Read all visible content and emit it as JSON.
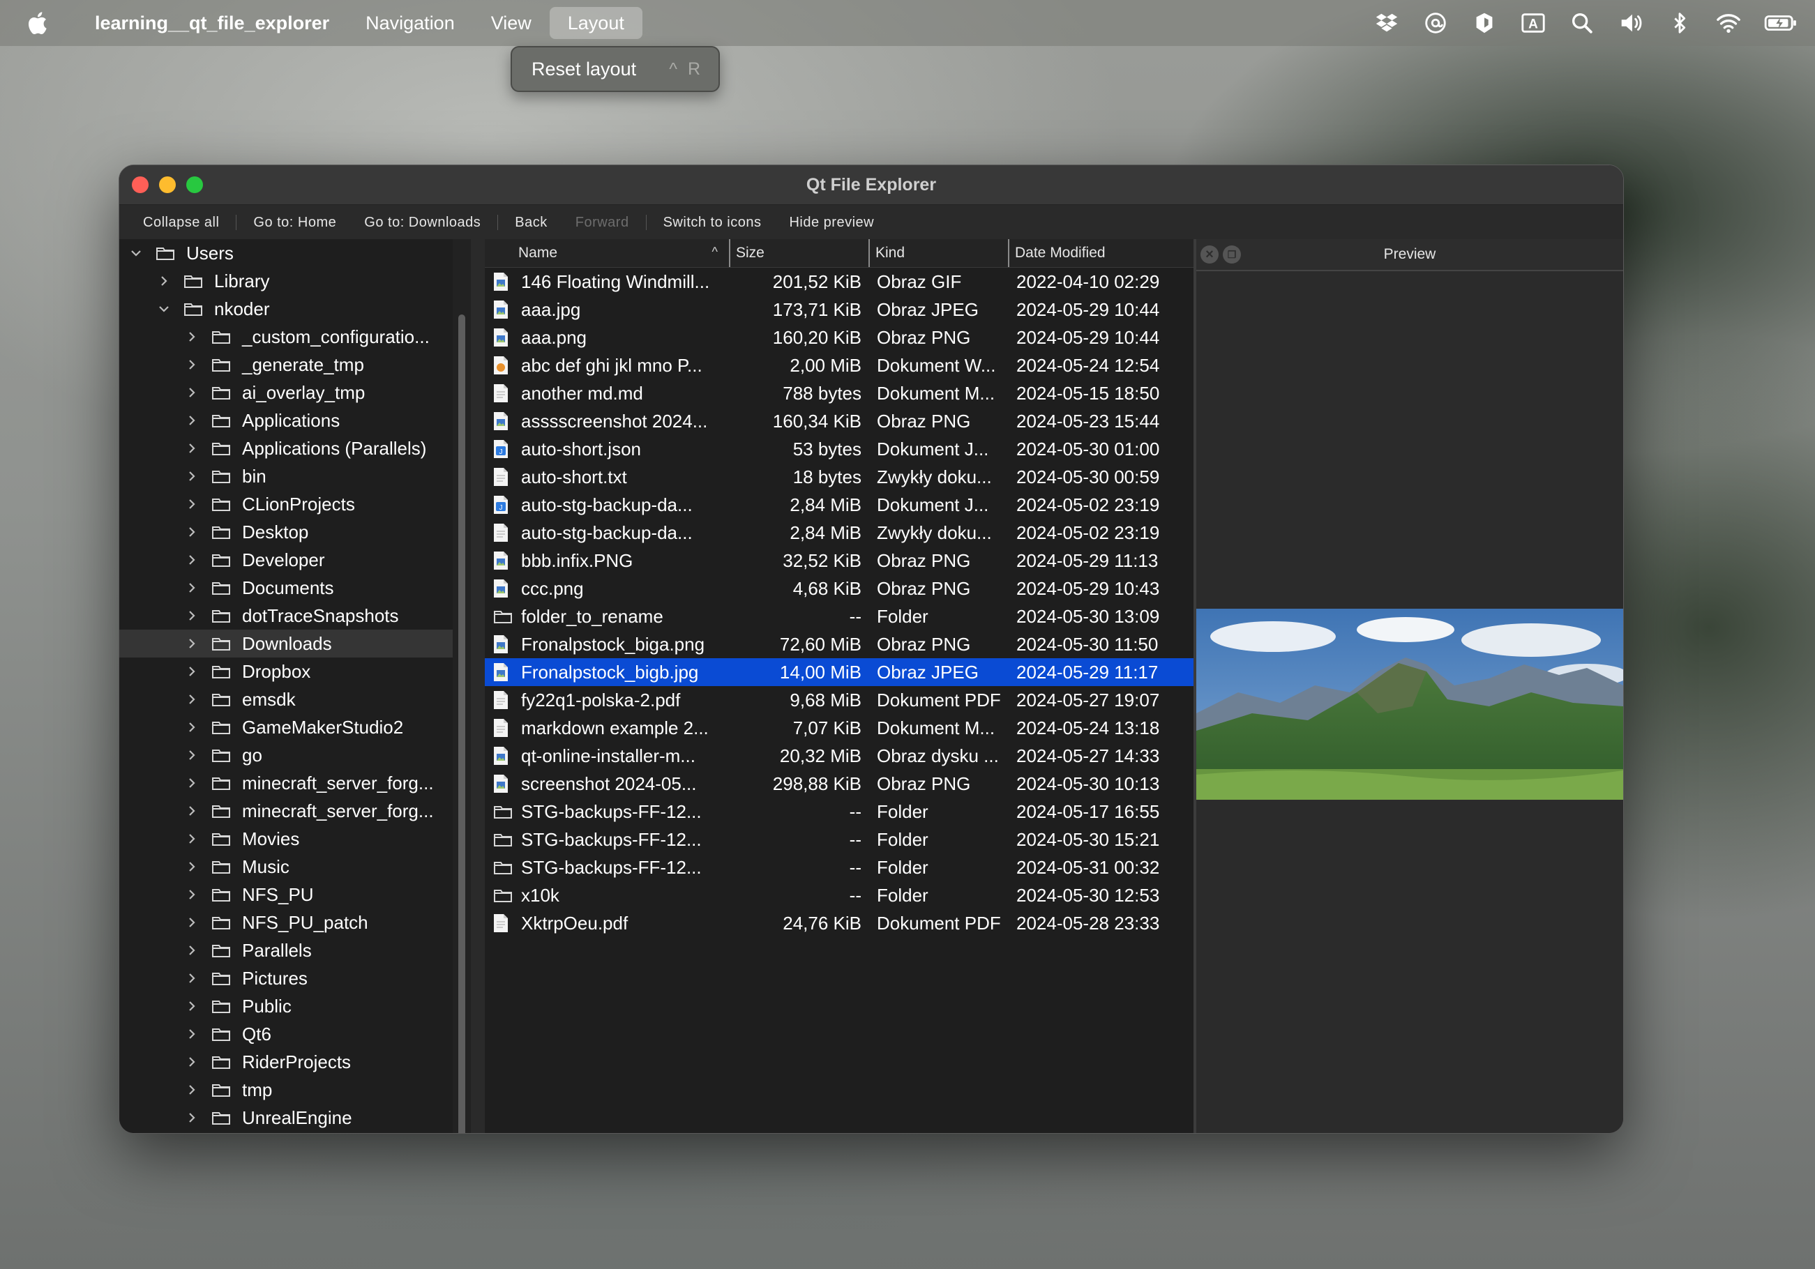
{
  "menubar": {
    "app_name": "learning__qt_file_explorer",
    "items": [
      "Navigation",
      "View",
      "Layout"
    ],
    "active_item": "Layout"
  },
  "layout_menu": {
    "reset_label": "Reset layout",
    "reset_shortcut": "^ R"
  },
  "window": {
    "title": "Qt File Explorer"
  },
  "toolbar": {
    "collapse_all": "Collapse all",
    "go_home": "Go to: Home",
    "go_downloads": "Go to: Downloads",
    "back": "Back",
    "forward": "Forward",
    "switch_icons": "Switch to icons",
    "hide_preview": "Hide preview"
  },
  "tree": {
    "root": "Users",
    "library": "Library",
    "user": "nkoder",
    "selected": "Downloads",
    "items": [
      "_custom_configuratio...",
      "_generate_tmp",
      "ai_overlay_tmp",
      "Applications",
      "Applications (Parallels)",
      "bin",
      "CLionProjects",
      "Desktop",
      "Developer",
      "Documents",
      "dotTraceSnapshots",
      "Downloads",
      "Dropbox",
      "emsdk",
      "GameMakerStudio2",
      "go",
      "minecraft_server_forg...",
      "minecraft_server_forg...",
      "Movies",
      "Music",
      "NFS_PU",
      "NFS_PU_patch",
      "Parallels",
      "Pictures",
      "Public",
      "Qt6",
      "RiderProjects",
      "tmp",
      "UnrealEngine"
    ]
  },
  "list": {
    "columns": {
      "name": "Name",
      "size": "Size",
      "kind": "Kind",
      "date": "Date Modified"
    },
    "sort_indicator": "^",
    "selected_name": "Fronalpstock_bigb.jpg",
    "rows": [
      {
        "name": "146 Floating Windmill...",
        "size": "201,52 KiB",
        "kind": "Obraz GIF",
        "date": "2022-04-10 02:29",
        "icon": "image-file"
      },
      {
        "name": "aaa.jpg",
        "size": "173,71 KiB",
        "kind": "Obraz JPEG",
        "date": "2024-05-29 10:44",
        "icon": "image-file"
      },
      {
        "name": "aaa.png",
        "size": "160,20 KiB",
        "kind": "Obraz PNG",
        "date": "2024-05-29 10:44",
        "icon": "image-file"
      },
      {
        "name": "abc def ghi jkl mno P...",
        "size": "2,00 MiB",
        "kind": "Dokument W...",
        "date": "2024-05-24 12:54",
        "icon": "orange-doc"
      },
      {
        "name": "another md.md",
        "size": "788 bytes",
        "kind": "Dokument M...",
        "date": "2024-05-15 18:50",
        "icon": "text-file"
      },
      {
        "name": "asssscreenshot 2024...",
        "size": "160,34 KiB",
        "kind": "Obraz PNG",
        "date": "2024-05-23 15:44",
        "icon": "image-file"
      },
      {
        "name": "auto-short.json",
        "size": "53 bytes",
        "kind": "Dokument J...",
        "date": "2024-05-30 01:00",
        "icon": "json-file"
      },
      {
        "name": "auto-short.txt",
        "size": "18 bytes",
        "kind": "Zwykły doku...",
        "date": "2024-05-30 00:59",
        "icon": "text-file"
      },
      {
        "name": "auto-stg-backup-da...",
        "size": "2,84 MiB",
        "kind": "Dokument J...",
        "date": "2024-05-02 23:19",
        "icon": "json-file"
      },
      {
        "name": "auto-stg-backup-da...",
        "size": "2,84 MiB",
        "kind": "Zwykły doku...",
        "date": "2024-05-02 23:19",
        "icon": "text-file"
      },
      {
        "name": "bbb.infix.PNG",
        "size": "32,52 KiB",
        "kind": "Obraz PNG",
        "date": "2024-05-29 11:13",
        "icon": "image-file"
      },
      {
        "name": "ccc.png",
        "size": "4,68 KiB",
        "kind": "Obraz PNG",
        "date": "2024-05-29 10:43",
        "icon": "image-file"
      },
      {
        "name": "folder_to_rename",
        "size": "--",
        "kind": "Folder",
        "date": "2024-05-30 13:09",
        "icon": "folder"
      },
      {
        "name": "Fronalpstock_biga.png",
        "size": "72,60 MiB",
        "kind": "Obraz PNG",
        "date": "2024-05-30 11:50",
        "icon": "image-file"
      },
      {
        "name": "Fronalpstock_bigb.jpg",
        "size": "14,00 MiB",
        "kind": "Obraz JPEG",
        "date": "2024-05-29 11:17",
        "icon": "image-file"
      },
      {
        "name": "fy22q1-polska-2.pdf",
        "size": "9,68 MiB",
        "kind": "Dokument PDF",
        "date": "2024-05-27 19:07",
        "icon": "text-file"
      },
      {
        "name": "markdown example 2...",
        "size": "7,07 KiB",
        "kind": "Dokument M...",
        "date": "2024-05-24 13:18",
        "icon": "text-file"
      },
      {
        "name": "qt-online-installer-m...",
        "size": "20,32 MiB",
        "kind": "Obraz dysku ...",
        "date": "2024-05-27 14:33",
        "icon": "image-file"
      },
      {
        "name": "screenshot 2024-05...",
        "size": "298,88 KiB",
        "kind": "Obraz PNG",
        "date": "2024-05-30 10:13",
        "icon": "image-file"
      },
      {
        "name": "STG-backups-FF-12...",
        "size": "--",
        "kind": "Folder",
        "date": "2024-05-17 16:55",
        "icon": "folder"
      },
      {
        "name": "STG-backups-FF-12...",
        "size": "--",
        "kind": "Folder",
        "date": "2024-05-30 15:21",
        "icon": "folder"
      },
      {
        "name": "STG-backups-FF-12...",
        "size": "--",
        "kind": "Folder",
        "date": "2024-05-31 00:32",
        "icon": "folder"
      },
      {
        "name": "x10k",
        "size": "--",
        "kind": "Folder",
        "date": "2024-05-30 12:53",
        "icon": "folder"
      },
      {
        "name": "XktrpOeu.pdf",
        "size": "24,76 KiB",
        "kind": "Dokument PDF",
        "date": "2024-05-28 23:33",
        "icon": "text-file"
      }
    ]
  },
  "preview": {
    "title": "Preview",
    "close_icon": "close-icon",
    "float_icon": "float-icon",
    "image_subject": "mountain-landscape"
  },
  "colors": {
    "selection": "#0a4bd4",
    "close": "#fe5f57",
    "minimize": "#febc2e",
    "maximize": "#28c840"
  }
}
